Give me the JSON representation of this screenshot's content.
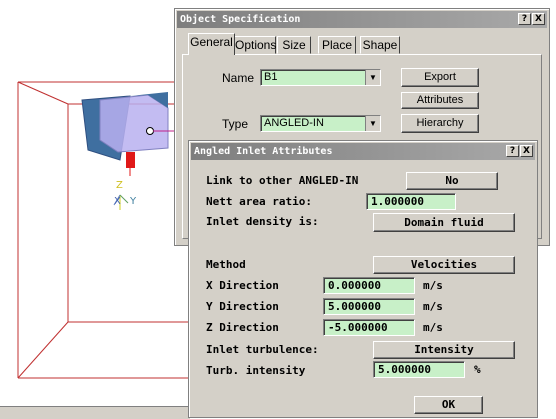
{
  "viewport": {
    "axis_labels": {
      "z": "Z",
      "x": "X",
      "y": "Y"
    },
    "colors": {
      "frame": "#c03030",
      "object": "#3f6fa0",
      "highlight": "#b8b0f0",
      "link": "#c0208a",
      "marker": "#e01818",
      "axis": "#d0d020"
    }
  },
  "object_spec": {
    "title": "Object Specification",
    "help_btn": "?",
    "close_btn": "X",
    "tabs": [
      {
        "label": "General",
        "active": true
      },
      {
        "label": "Options"
      },
      {
        "label": "Size"
      },
      {
        "label": "Place"
      },
      {
        "label": "Shape"
      }
    ],
    "name_label": "Name",
    "name_value": "B1",
    "type_label": "Type",
    "type_value": "ANGLED-IN",
    "export_btn": "Export",
    "attributes_btn": "Attributes",
    "hierarchy_btn": "Hierarchy"
  },
  "inlet_attrs": {
    "title": "Angled Inlet Attributes",
    "help_btn": "?",
    "close_btn": "X",
    "link_label": "Link to other ANGLED-IN",
    "link_value": "No",
    "nett_label": "Nett area ratio:",
    "nett_value": "1.000000",
    "density_label": "Inlet density is:",
    "density_value": "Domain fluid",
    "method_label": "Method",
    "method_value": "Velocities",
    "x_label": "X Direction",
    "x_value": "0.000000",
    "y_label": "Y Direction",
    "y_value": "5.000000",
    "z_label": "Z Direction",
    "z_value": "-5.000000",
    "unit": "m/s",
    "turb_label": "Inlet turbulence:",
    "turb_value": "Intensity",
    "turb_int_label": "Turb. intensity",
    "turb_int_value": "5.000000",
    "percent": "%",
    "ok_btn": "OK"
  }
}
